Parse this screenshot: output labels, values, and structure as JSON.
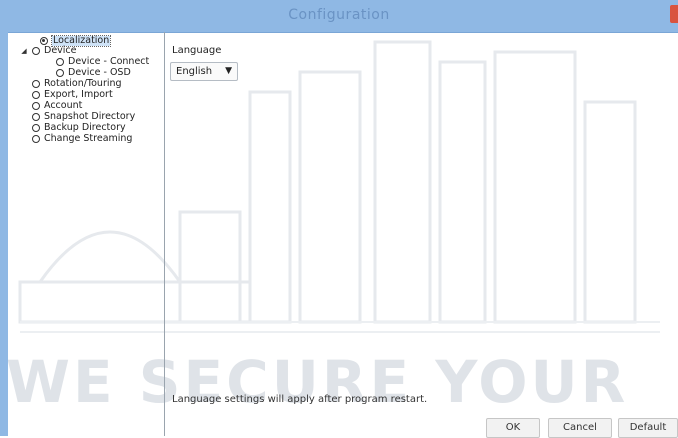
{
  "window": {
    "title": "Configuration"
  },
  "watermark": {
    "text": "WE SECURE YOUR"
  },
  "tree": {
    "items": [
      {
        "label": "Localization",
        "selected": true,
        "expander": ""
      },
      {
        "label": "Device",
        "selected": false,
        "expander": "◢"
      },
      {
        "label": "Device - Connect",
        "selected": false,
        "expander": ""
      },
      {
        "label": "Device - OSD",
        "selected": false,
        "expander": ""
      },
      {
        "label": "Rotation/Touring",
        "selected": false,
        "expander": ""
      },
      {
        "label": "Export, Import",
        "selected": false,
        "expander": ""
      },
      {
        "label": "Account",
        "selected": false,
        "expander": ""
      },
      {
        "label": "Snapshot Directory",
        "selected": false,
        "expander": ""
      },
      {
        "label": "Backup Directory",
        "selected": false,
        "expander": ""
      },
      {
        "label": "Change Streaming",
        "selected": false,
        "expander": ""
      }
    ]
  },
  "content": {
    "language_label": "Language",
    "language_value": "English",
    "notice": "Language settings will apply after program restart."
  },
  "buttons": {
    "ok": "OK",
    "cancel": "Cancel",
    "default": "Default"
  },
  "colors": {
    "titlebar": "#8fb8e4",
    "close": "#d9533f",
    "selection": "#cfe3f7"
  }
}
